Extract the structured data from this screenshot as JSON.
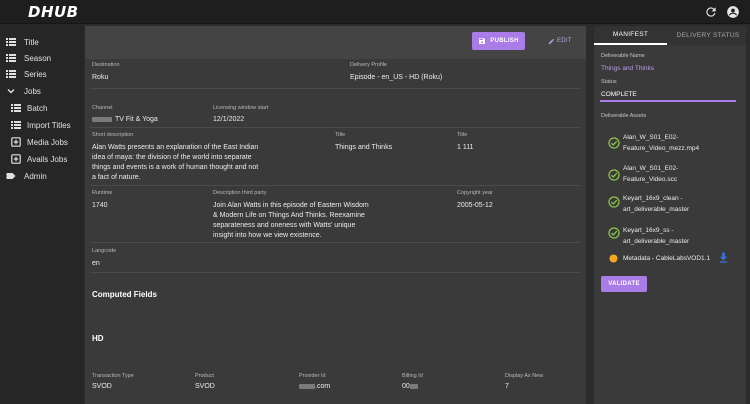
{
  "app": {
    "logo_text": "DHUB"
  },
  "topbar": {
    "icons": [
      "refresh-icon",
      "account-icon"
    ]
  },
  "sidebar": {
    "items": [
      {
        "label": "Title",
        "icon": "list-icon"
      },
      {
        "label": "Season",
        "icon": "list-icon"
      },
      {
        "label": "Series",
        "icon": "list-icon"
      },
      {
        "label": "Jobs",
        "icon": "chevron-down-icon"
      },
      {
        "label": "Batch",
        "icon": "list-icon"
      },
      {
        "label": "Import Titles",
        "icon": "list-icon"
      },
      {
        "label": "Media Jobs",
        "icon": "add-box-icon"
      },
      {
        "label": "Avails Jobs",
        "icon": "add-box-icon"
      },
      {
        "label": "Admin",
        "icon": "label-icon"
      }
    ]
  },
  "main": {
    "actions": {
      "publish": "PUBLISH",
      "edit": "EDIT"
    },
    "fields": {
      "destination": {
        "label": "Destination",
        "value": "Roku"
      },
      "delivery_profile": {
        "label": "Delivery Profile",
        "value": "Episode - en_US - HD (Roku)"
      },
      "channel": {
        "label": "Channel",
        "value": "TV Fit & Yoga"
      },
      "licensing_window_start": {
        "label": "Licensing window start",
        "value": "12/1/2022"
      },
      "short_description": {
        "label": "Short description",
        "value": "Alan Watts presents an explanation of the East Indian idea of maya: the division of the world into separate things and events is a work of human thought and not a fact of nature."
      },
      "title_a": {
        "label": "Title",
        "value": "Things and Thinks"
      },
      "title_b": {
        "label": "Title",
        "value": "1 111"
      },
      "runtime": {
        "label": "Runtime",
        "value": "1740"
      },
      "description_third_party": {
        "label": "Description third party",
        "value": "Join Alan Watts in this episode of Eastern Wisdom & Modern Life on Things And Thinks. Reexamine separateness and oneness with Watts' unique insight into how we view existence."
      },
      "copyright_year": {
        "label": "Copyright year",
        "value": "2005-05-12"
      },
      "langcode": {
        "label": "Langcode",
        "value": "en"
      }
    },
    "computed_fields_title": "Computed Fields",
    "hd_title": "HD",
    "hd_fields": {
      "transaction_type": {
        "label": "Transaction Type",
        "value": "SVOD"
      },
      "product": {
        "label": "Product",
        "value": "SVOD"
      },
      "provider_id": {
        "label": "Provider Id",
        "value": ".com"
      },
      "billing_id": {
        "label": "Billing Id",
        "value": "00"
      },
      "display_ax_new": {
        "label": "Display Ax New",
        "value": "7"
      }
    }
  },
  "right_panel": {
    "tabs": {
      "manifest": "MANIFEST",
      "delivery_status": "DELIVERY STATUS"
    },
    "deliverable_name": {
      "label": "Deliverable Name",
      "value": "Things and Thinks"
    },
    "status": {
      "label": "Status",
      "value": "COMPLETE"
    },
    "assets_label": "Deliverable Assets",
    "assets": [
      {
        "line1": "Alan_W_S01_E02-",
        "line2": "Feature_Video_mezz.mp4",
        "state": "complete"
      },
      {
        "line1": "Alan_W_S01_E02-",
        "line2": "Feature_Video.scc",
        "state": "complete"
      },
      {
        "line1": "Keyart_16x9_clean -",
        "line2": "art_deliverable_master",
        "state": "complete"
      },
      {
        "line1": "Keyart_16x9_ss -",
        "line2": "art_deliverable_master",
        "state": "complete"
      },
      {
        "line1": "Metadata - CableLabsVOD1.1",
        "line2": "",
        "state": "pending"
      }
    ],
    "validate": "VALIDATE"
  },
  "colors": {
    "accent": "#a97ce8",
    "success": "#8bc34a",
    "pending": "#f5a623",
    "link": "#b9a1e6",
    "download": "#3b6fd8"
  }
}
